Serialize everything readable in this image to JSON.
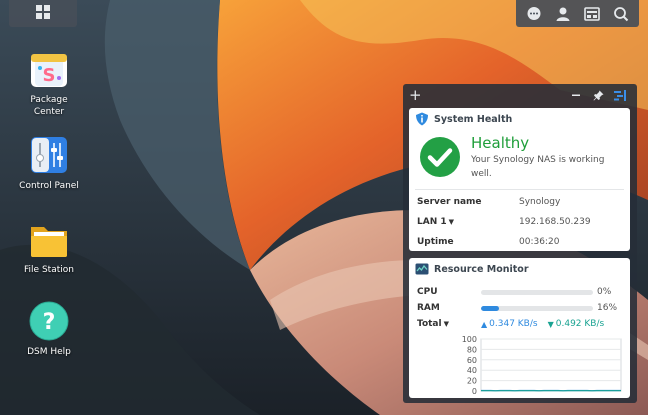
{
  "desktop_icons": [
    {
      "id": "package",
      "label_lines": [
        "Package",
        "Center"
      ]
    },
    {
      "id": "control",
      "label_lines": [
        "Control Panel"
      ]
    },
    {
      "id": "file",
      "label_lines": [
        "File Station"
      ]
    },
    {
      "id": "help",
      "label_lines": [
        "DSM Help"
      ]
    }
  ],
  "topbar": {
    "left_icon": "grid-icon",
    "right_icons": [
      "chat-icon",
      "user-icon",
      "widgets-icon",
      "search-icon"
    ]
  },
  "widget_panel": {
    "add_label": "+",
    "tools": [
      "minimize-icon",
      "pin-icon",
      "layout-icon"
    ]
  },
  "system_health": {
    "title": "System Health",
    "status": "Healthy",
    "message_line1": "Your Synology NAS is working",
    "message_line2": "well.",
    "rows": [
      {
        "key": "Server name",
        "value": "Synology",
        "dropdown": false
      },
      {
        "key": "LAN 1",
        "value": "192.168.50.239",
        "dropdown": true
      },
      {
        "key": "Uptime",
        "value": "00:36:20",
        "dropdown": false
      }
    ]
  },
  "resource_monitor": {
    "title": "Resource Monitor",
    "cpu": {
      "label": "CPU",
      "percent": 0,
      "percent_text": "0%"
    },
    "ram": {
      "label": "RAM",
      "percent": 16,
      "percent_text": "16%"
    },
    "total": {
      "label": "Total",
      "upload": "0.347 KB/s",
      "download": "0.492 KB/s"
    }
  },
  "chart_data": {
    "type": "area",
    "ylim": [
      0,
      100
    ],
    "yticks": [
      "100",
      "80",
      "60",
      "40",
      "20",
      "0"
    ],
    "series": [
      {
        "values": [
          1,
          1,
          1,
          0.5,
          1,
          1,
          1,
          0.5,
          1,
          1,
          1,
          1,
          0.5,
          1,
          1,
          1,
          1,
          0.5,
          1,
          1,
          1,
          1,
          1,
          0.5,
          1,
          1,
          1,
          1,
          1,
          1
        ]
      },
      {
        "values": [
          0.5,
          0.5,
          0.5,
          0.3,
          0.5,
          0.5,
          0.5,
          0.3,
          0.5,
          0.5,
          0.5,
          0.5,
          0.3,
          0.5,
          0.5,
          0.5,
          0.5,
          0.3,
          0.5,
          0.5,
          0.5,
          0.5,
          0.5,
          0.3,
          0.5,
          0.5,
          0.5,
          0.5,
          0.5,
          0.5
        ]
      }
    ],
    "colors": [
      "#2f8adf",
      "#1aa392"
    ],
    "grid": true
  }
}
